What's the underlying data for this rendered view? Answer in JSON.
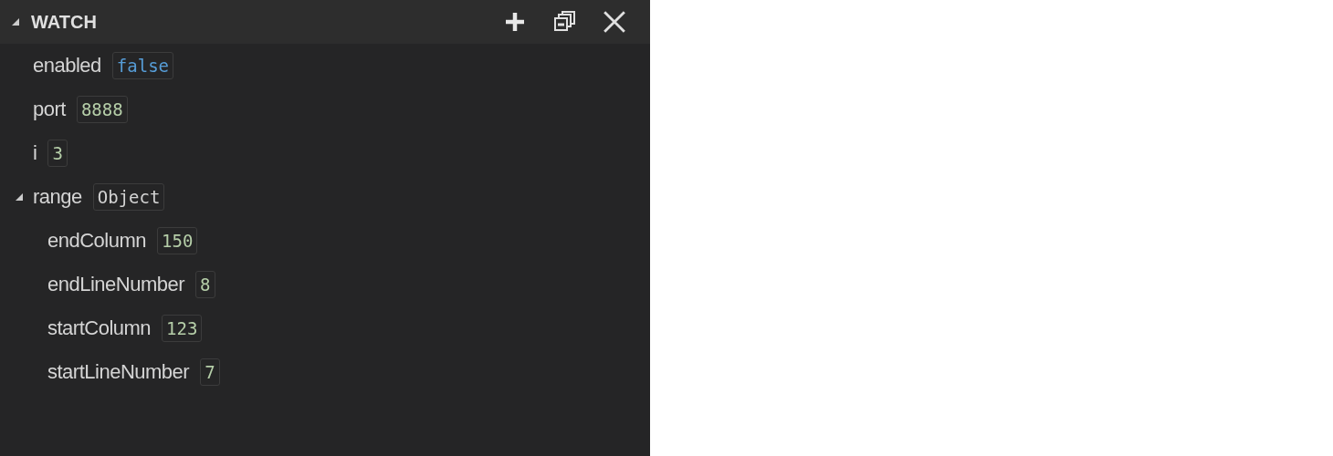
{
  "panel": {
    "title": "WATCH",
    "expanded": true
  },
  "variables": [
    {
      "name": "enabled",
      "value": "false",
      "kind": "boolean"
    },
    {
      "name": "port",
      "value": "8888",
      "kind": "number"
    },
    {
      "name": "i",
      "value": "3",
      "kind": "number"
    },
    {
      "name": "range",
      "value": "Object",
      "kind": "object",
      "expanded": true,
      "children": [
        {
          "name": "endColumn",
          "value": "150",
          "kind": "number"
        },
        {
          "name": "endLineNumber",
          "value": "8",
          "kind": "number"
        },
        {
          "name": "startColumn",
          "value": "123",
          "kind": "number"
        },
        {
          "name": "startLineNumber",
          "value": "7",
          "kind": "number"
        }
      ]
    }
  ]
}
